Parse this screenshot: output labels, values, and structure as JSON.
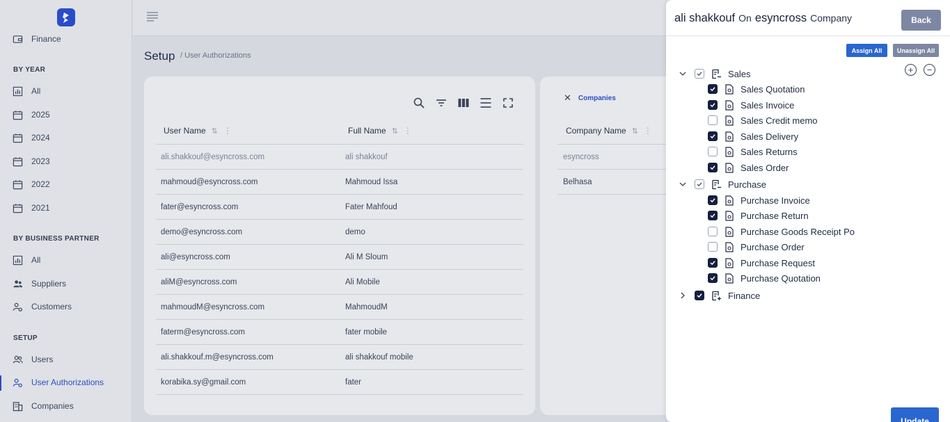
{
  "sidebar": {
    "top_item": "Finance",
    "by_year_heading": "BY YEAR",
    "years": [
      "All",
      "2025",
      "2024",
      "2023",
      "2022",
      "2021"
    ],
    "by_bp_heading": "BY BUSINESS PARTNER",
    "bp_items": [
      "All",
      "Suppliers",
      "Customers"
    ],
    "setup_heading": "SETUP",
    "setup_items": [
      "Users",
      "User Authorizations",
      "Companies"
    ]
  },
  "page": {
    "title": "Setup",
    "breadcrumb": "/ User Authorizations"
  },
  "users_table": {
    "headers": [
      "User Name",
      "Full Name"
    ],
    "rows": [
      [
        "ali.shakkouf@esyncross.com",
        "ali shakkouf"
      ],
      [
        "mahmoud@esyncross.com",
        "Mahmoud Issa"
      ],
      [
        "fater@esyncross.com",
        "Fater Mahfoud"
      ],
      [
        "demo@esyncross.com",
        "demo"
      ],
      [
        "ali@esyncross.com",
        "Ali M Sloum"
      ],
      [
        "aliM@esyncross.com",
        "Ali Mobile"
      ],
      [
        "mahmoudM@esyncross.com",
        "MahmoudM"
      ],
      [
        "faterm@esyncross.com",
        "fater mobile"
      ],
      [
        "ali.shakkouf.m@esyncross.com",
        "ali shakkouf mobile"
      ],
      [
        "korabika.sy@gmail.com",
        "fater"
      ]
    ]
  },
  "companies_table": {
    "tag": "Companies",
    "header": "Company Name",
    "rows": [
      "esyncross",
      "Belhasa"
    ]
  },
  "panel": {
    "user": "ali shakkouf",
    "on": "On",
    "company": "esyncross",
    "company_suffix": "Company",
    "back": "Back",
    "assign_all": "Assign All",
    "unassign_all": "Unassign All",
    "update": "Update",
    "groups": [
      {
        "label": "Sales",
        "expanded": true,
        "items": [
          {
            "label": "Sales Quotation",
            "checked": true
          },
          {
            "label": "Sales Invoice",
            "checked": true
          },
          {
            "label": "Sales Credit memo",
            "checked": false
          },
          {
            "label": "Sales Delivery",
            "checked": true
          },
          {
            "label": "Sales Returns",
            "checked": false
          },
          {
            "label": "Sales Order",
            "checked": true
          }
        ]
      },
      {
        "label": "Purchase",
        "expanded": true,
        "items": [
          {
            "label": "Purchase Invoice",
            "checked": true
          },
          {
            "label": "Purchase Return",
            "checked": true
          },
          {
            "label": "Purchase Goods Receipt Po",
            "checked": false
          },
          {
            "label": "Purchase Order",
            "checked": false
          },
          {
            "label": "Purchase Request",
            "checked": true
          },
          {
            "label": "Purchase Quotation",
            "checked": true
          }
        ]
      },
      {
        "label": "Finance",
        "expanded": false,
        "items": []
      }
    ]
  },
  "colors": {
    "accent": "#2a66cf",
    "checked": "#14213d",
    "muted_button": "#7d87a3"
  }
}
